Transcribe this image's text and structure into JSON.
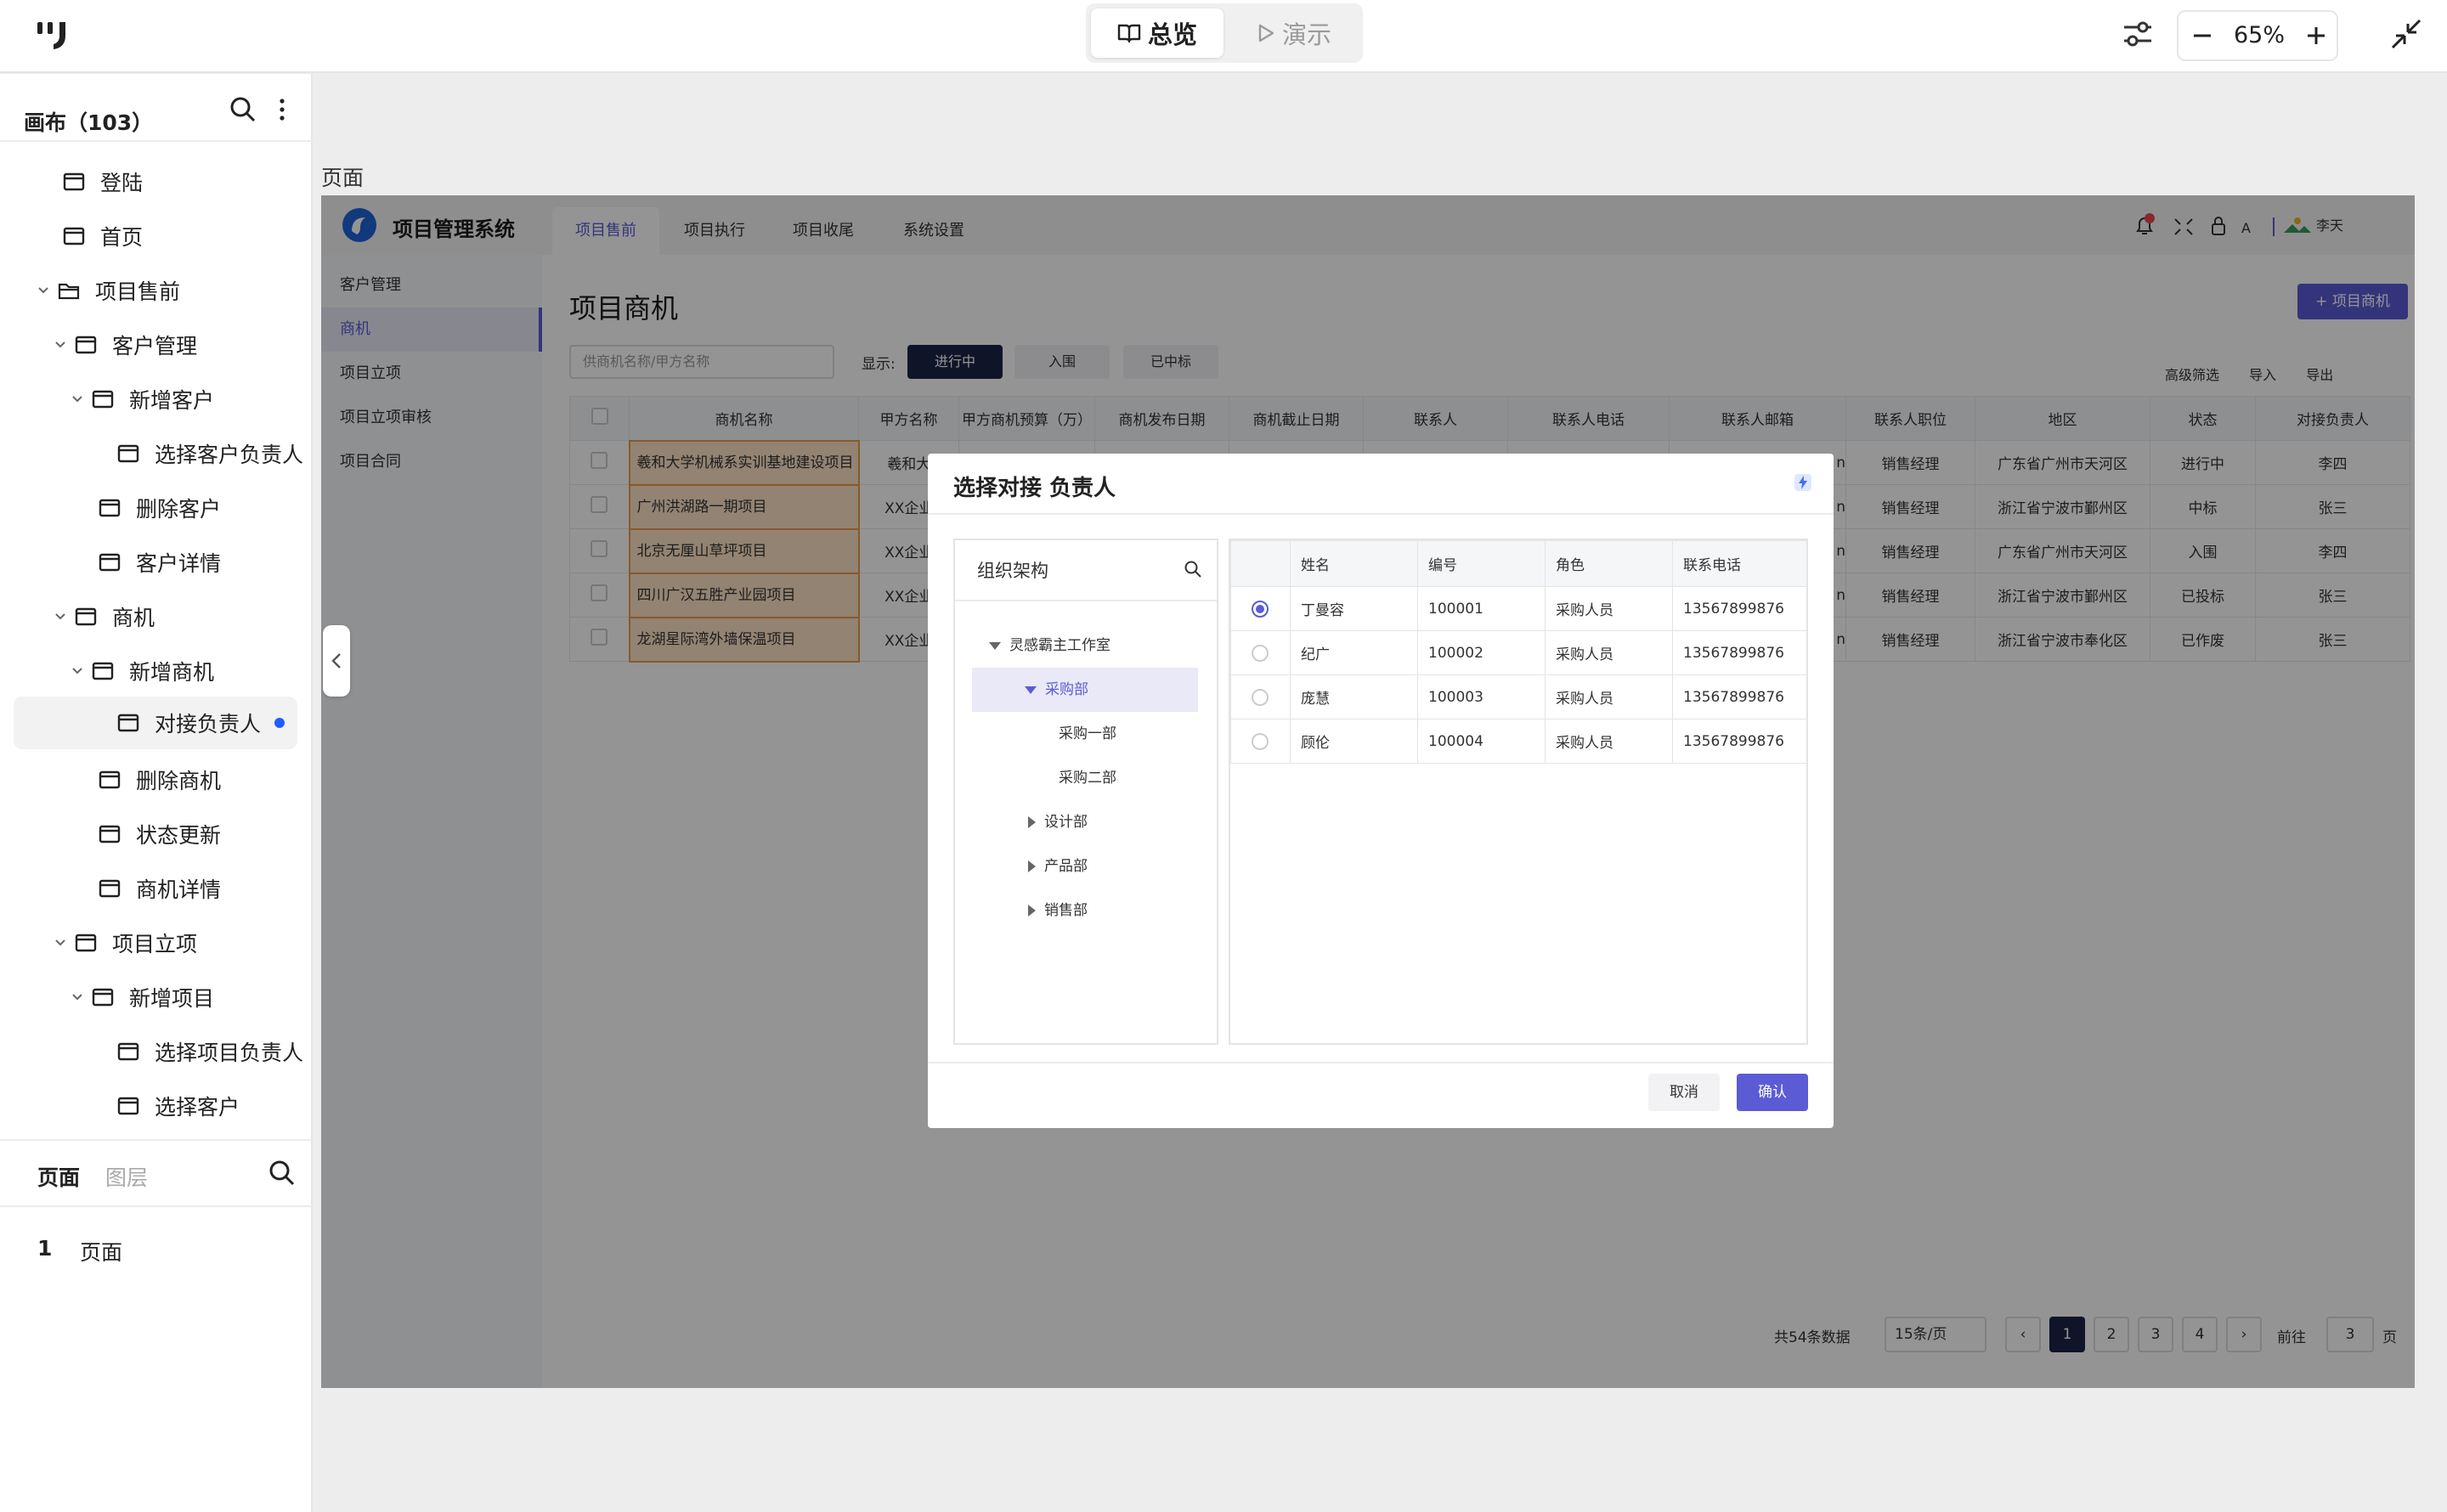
{
  "topbar": {
    "tab_overview": "总览",
    "tab_present": "演示",
    "zoom": "65%"
  },
  "sidebar": {
    "canvas_title": "画布（103）",
    "tree": [
      {
        "label": "登陆"
      },
      {
        "label": "首页"
      },
      {
        "label": "项目售前"
      },
      {
        "label": "客户管理"
      },
      {
        "label": "新增客户"
      },
      {
        "label": "选择客户负责人"
      },
      {
        "label": "删除客户"
      },
      {
        "label": "客户详情"
      },
      {
        "label": "商机"
      },
      {
        "label": "新增商机"
      },
      {
        "label": "对接负责人"
      },
      {
        "label": "删除商机"
      },
      {
        "label": "状态更新"
      },
      {
        "label": "商机详情"
      },
      {
        "label": "项目立项"
      },
      {
        "label": "新增项目"
      },
      {
        "label": "选择项目负责人"
      },
      {
        "label": "选择客户"
      }
    ],
    "bottom_tab_pages": "页面",
    "bottom_tab_layers": "图层",
    "page_number": "1",
    "page_name": "页面"
  },
  "canvas": {
    "frame_label": "页面"
  },
  "app": {
    "title": "项目管理系统",
    "nav": [
      "项目售前",
      "项目执行",
      "项目收尾",
      "系统设置"
    ],
    "notification_count": "1",
    "user": "李天",
    "side": [
      "客户管理",
      "商机",
      "项目立项",
      "项目立项审核",
      "项目合同"
    ],
    "main_title": "项目商机",
    "add_button": "+ 项目商机",
    "search_placeholder": "供商机名称/甲方名称",
    "show_label": "显示:",
    "filters": [
      "进行中",
      "入围",
      "已中标"
    ],
    "tool_filter": "高级筛选",
    "tool_import": "导入",
    "tool_export": "导出",
    "columns": [
      "商机名称",
      "甲方名称",
      "甲方商机预算（万）",
      "商机发布日期",
      "商机截止日期",
      "联系人",
      "联系人电话",
      "联系人邮箱",
      "联系人职位",
      "地区",
      "状态",
      "对接负责人"
    ],
    "rows": [
      {
        "name": "羲和大学机械系实训基地建设项目",
        "party": "羲和大",
        "email": "n",
        "position": "销售经理",
        "region": "广东省广州市天河区",
        "status": "进行中",
        "owner": "李四"
      },
      {
        "name": "广州洪湖路一期项目",
        "party": "XX企业",
        "email": "n",
        "position": "销售经理",
        "region": "浙江省宁波市鄞州区",
        "status": "中标",
        "owner": "张三"
      },
      {
        "name": "北京无厘山草坪项目",
        "party": "XX企业",
        "email": "n",
        "position": "销售经理",
        "region": "广东省广州市天河区",
        "status": "入围",
        "owner": "李四"
      },
      {
        "name": "四川广汉五胜产业园项目",
        "party": "XX企业",
        "email": "n",
        "position": "销售经理",
        "region": "浙江省宁波市鄞州区",
        "status": "已投标",
        "owner": "张三"
      },
      {
        "name": "龙湖星际湾外墙保温项目",
        "party": "XX企业",
        "email": "n",
        "position": "销售经理",
        "region": "浙江省宁波市奉化区",
        "status": "已作废",
        "owner": "张三"
      }
    ],
    "pager": {
      "total": "共54条数据",
      "page_size": "15条/页",
      "pages": [
        "1",
        "2",
        "3",
        "4"
      ],
      "goto_label": "前往",
      "goto_value": "3",
      "goto_suffix": "页"
    }
  },
  "modal": {
    "title": "选择对接 负责人",
    "org_title": "组织架构",
    "org_tree": [
      {
        "label": "灵感霸主工作室"
      },
      {
        "label": "采购部"
      },
      {
        "label": "采购一部"
      },
      {
        "label": "采购二部"
      },
      {
        "label": "设计部"
      },
      {
        "label": "产品部"
      },
      {
        "label": "销售部"
      }
    ],
    "columns": [
      "姓名",
      "编号",
      "角色",
      "联系电话"
    ],
    "users": [
      {
        "name": "丁曼容",
        "id": "100001",
        "role": "采购人员",
        "phone": "13567899876"
      },
      {
        "name": "纪广",
        "id": "100002",
        "role": "采购人员",
        "phone": "13567899876"
      },
      {
        "name": "庞慧",
        "id": "100003",
        "role": "采购人员",
        "phone": "13567899876"
      },
      {
        "name": "顾伦",
        "id": "100004",
        "role": "采购人员",
        "phone": "13567899876"
      }
    ],
    "cancel": "取消",
    "confirm": "确认"
  },
  "colors": {
    "accent": "#5b5bd6",
    "dark": "#1a2346",
    "highlight": "#fde2c4",
    "dot": "#1e5eff"
  }
}
